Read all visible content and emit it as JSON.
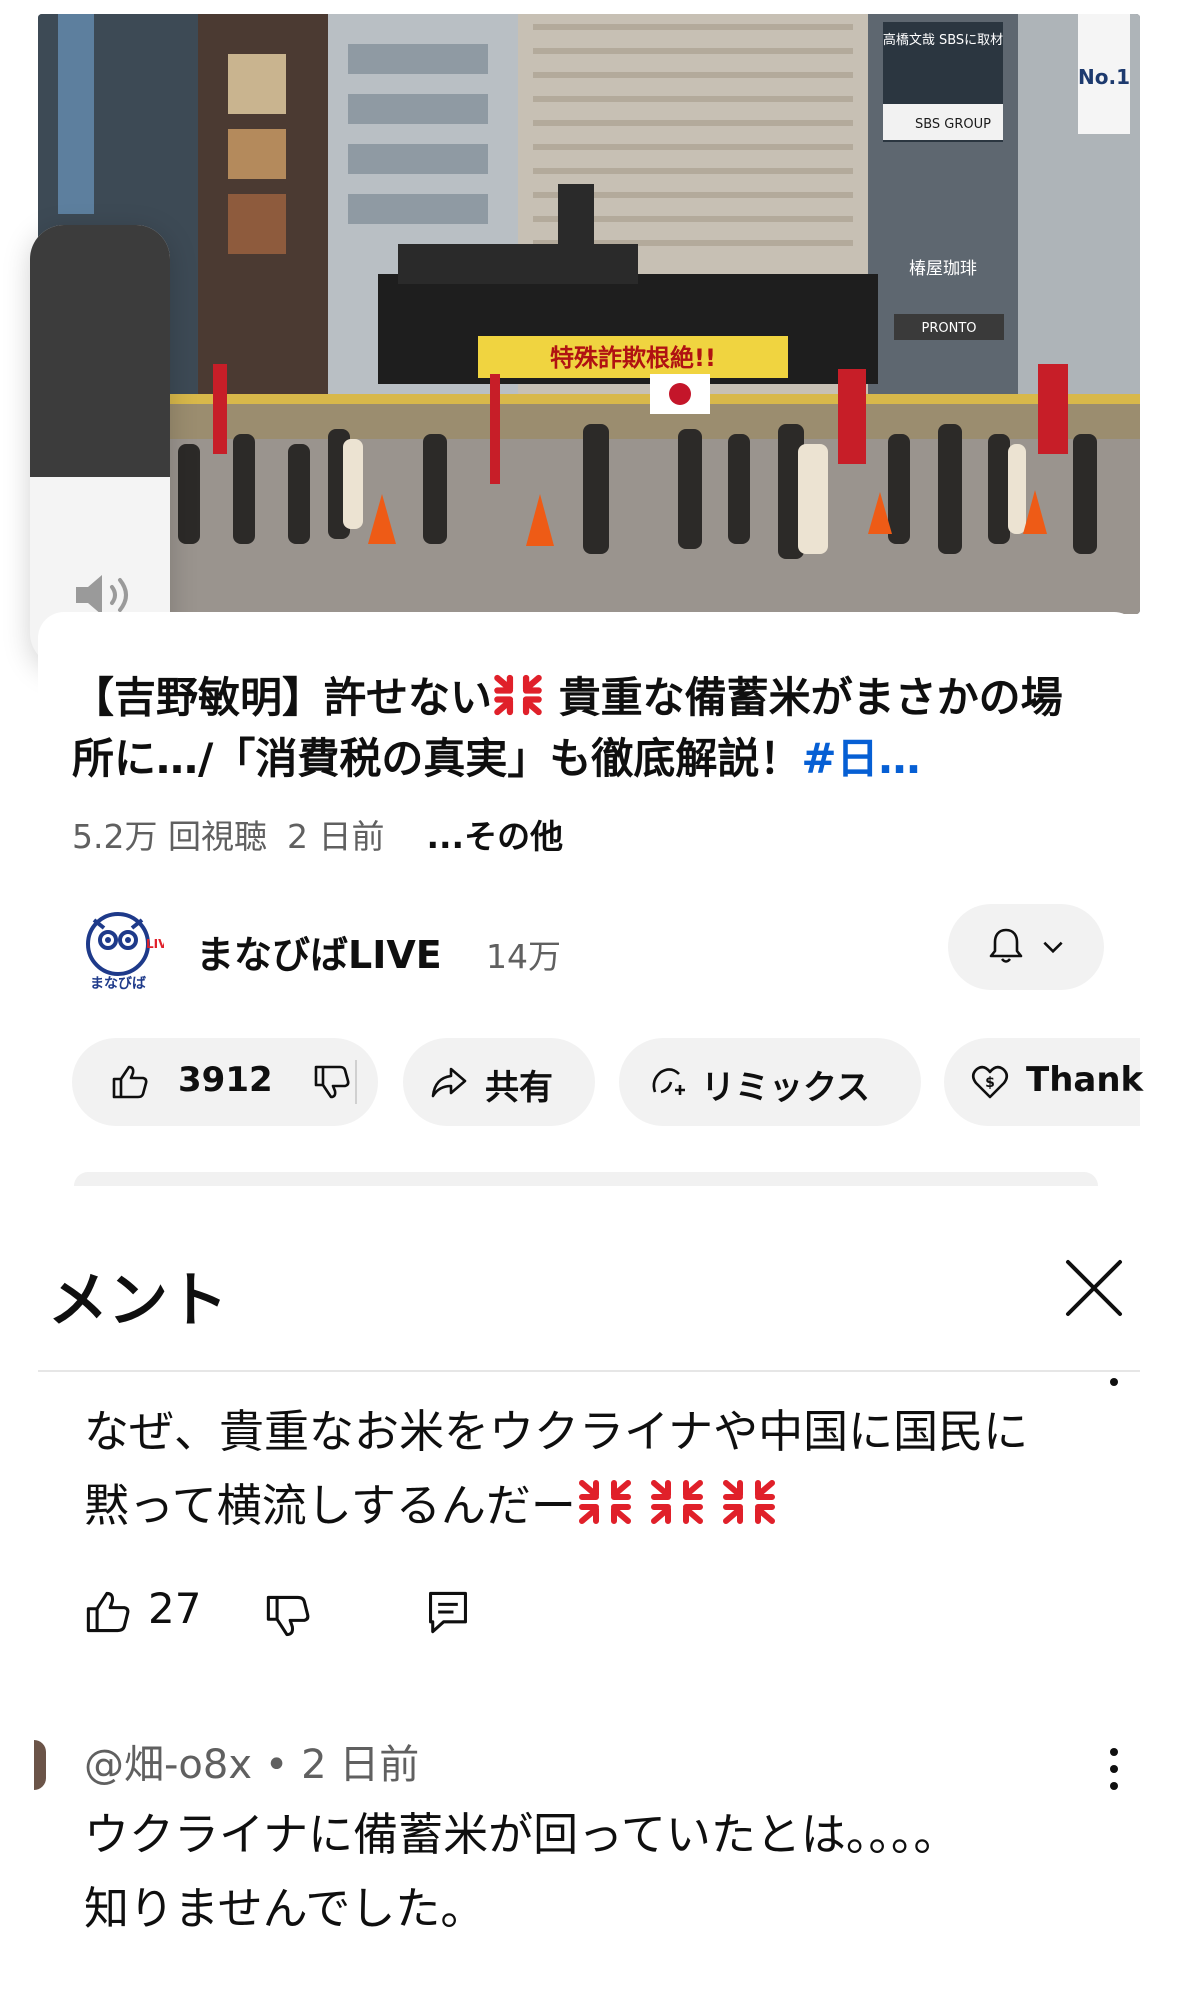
{
  "video": {
    "banner_text": "特殊詐欺根絶!!",
    "billboard_text": "高橋文哉 SBSに取材",
    "billboard_brand": "SBS GROUP",
    "storefront_text": "PRONTO",
    "cafe_sign": "椿屋珈琲",
    "no1_sign": "No.1"
  },
  "volume": {
    "level": 0.43,
    "icon": "speaker-icon"
  },
  "title": {
    "part1": "【吉野敏明】許せない",
    "part2": " 貴重な備蓄米がまさかの場所に…/「消費税の真実」も徹底解説！",
    "hashtag": "#日…"
  },
  "meta": {
    "views": "5.2万 回視聴",
    "age": "2 日前",
    "more": "...その他"
  },
  "channel": {
    "name": "まなびばLIVE",
    "subs": "14万",
    "logo_text": "まなびば"
  },
  "actions": {
    "likes": "3912",
    "share": "共有",
    "remix": "リミックス",
    "thanks": "Thank"
  },
  "comments": {
    "header": "メント",
    "items": [
      {
        "text_line1": "なぜ、貴重なお米をウクライナや中国に国民に",
        "text_line2": "黙って横流しするんだー",
        "likes": "27"
      },
      {
        "author": "@畑-o8x",
        "age": "2 日前",
        "text_line1": "ウクライナに備蓄米が回っていたとは。。。。",
        "text_line2": "知りませんでした。"
      }
    ]
  },
  "colors": {
    "link": "#065fd4",
    "anger": "#e0202a",
    "chip": "#f2f2f2"
  }
}
